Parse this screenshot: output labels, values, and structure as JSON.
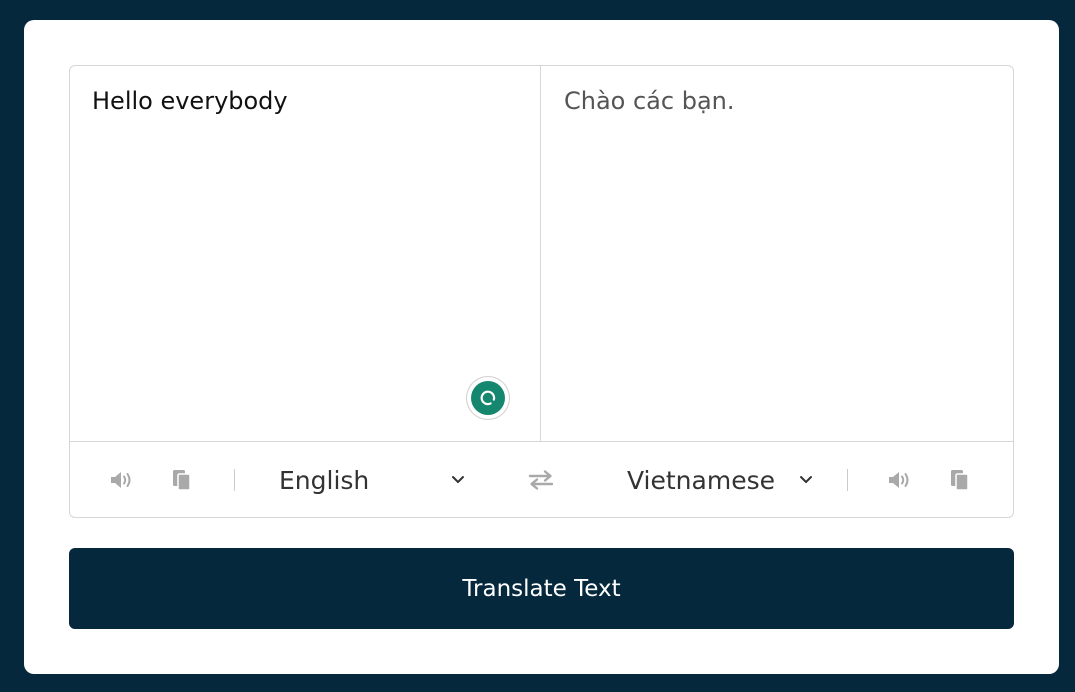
{
  "source": {
    "text": "Hello everybody",
    "language": "English",
    "speak_icon": "volume-icon",
    "copy_icon": "copy-icon"
  },
  "target": {
    "text": "Chào các bạn.",
    "language": "Vietnamese",
    "speak_icon": "volume-icon",
    "copy_icon": "copy-icon"
  },
  "swap_icon": "exchange-icon",
  "grammarly_icon": "grammarly-icon",
  "translate_button": {
    "label": "Translate Text"
  },
  "colors": {
    "background": "#06283d",
    "card": "#ffffff",
    "button": "#06283d",
    "icon": "#a9a9a9",
    "grammarly": "#15876e"
  }
}
